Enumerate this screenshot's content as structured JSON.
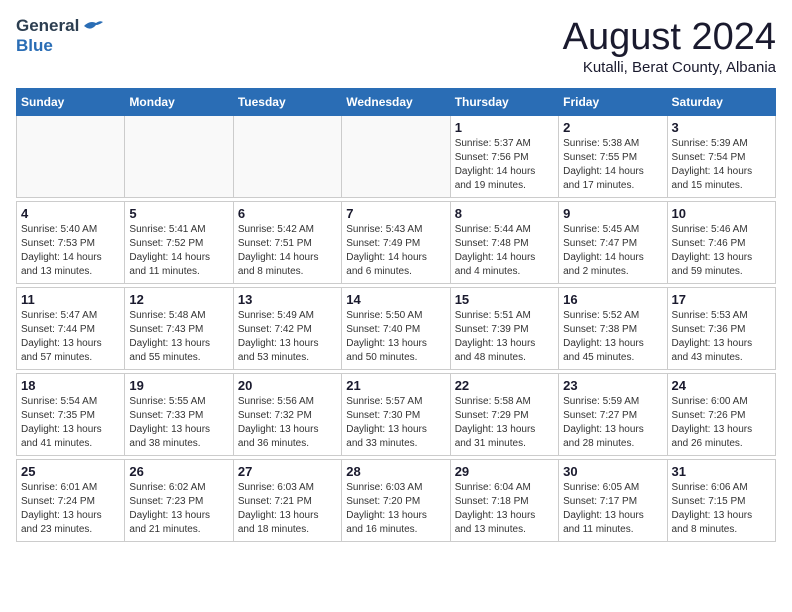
{
  "header": {
    "logo_general": "General",
    "logo_blue": "Blue",
    "month_year": "August 2024",
    "location": "Kutalli, Berat County, Albania"
  },
  "days_of_week": [
    "Sunday",
    "Monday",
    "Tuesday",
    "Wednesday",
    "Thursday",
    "Friday",
    "Saturday"
  ],
  "weeks": [
    [
      {
        "day": "",
        "info": ""
      },
      {
        "day": "",
        "info": ""
      },
      {
        "day": "",
        "info": ""
      },
      {
        "day": "",
        "info": ""
      },
      {
        "day": "1",
        "info": "Sunrise: 5:37 AM\nSunset: 7:56 PM\nDaylight: 14 hours\nand 19 minutes."
      },
      {
        "day": "2",
        "info": "Sunrise: 5:38 AM\nSunset: 7:55 PM\nDaylight: 14 hours\nand 17 minutes."
      },
      {
        "day": "3",
        "info": "Sunrise: 5:39 AM\nSunset: 7:54 PM\nDaylight: 14 hours\nand 15 minutes."
      }
    ],
    [
      {
        "day": "4",
        "info": "Sunrise: 5:40 AM\nSunset: 7:53 PM\nDaylight: 14 hours\nand 13 minutes."
      },
      {
        "day": "5",
        "info": "Sunrise: 5:41 AM\nSunset: 7:52 PM\nDaylight: 14 hours\nand 11 minutes."
      },
      {
        "day": "6",
        "info": "Sunrise: 5:42 AM\nSunset: 7:51 PM\nDaylight: 14 hours\nand 8 minutes."
      },
      {
        "day": "7",
        "info": "Sunrise: 5:43 AM\nSunset: 7:49 PM\nDaylight: 14 hours\nand 6 minutes."
      },
      {
        "day": "8",
        "info": "Sunrise: 5:44 AM\nSunset: 7:48 PM\nDaylight: 14 hours\nand 4 minutes."
      },
      {
        "day": "9",
        "info": "Sunrise: 5:45 AM\nSunset: 7:47 PM\nDaylight: 14 hours\nand 2 minutes."
      },
      {
        "day": "10",
        "info": "Sunrise: 5:46 AM\nSunset: 7:46 PM\nDaylight: 13 hours\nand 59 minutes."
      }
    ],
    [
      {
        "day": "11",
        "info": "Sunrise: 5:47 AM\nSunset: 7:44 PM\nDaylight: 13 hours\nand 57 minutes."
      },
      {
        "day": "12",
        "info": "Sunrise: 5:48 AM\nSunset: 7:43 PM\nDaylight: 13 hours\nand 55 minutes."
      },
      {
        "day": "13",
        "info": "Sunrise: 5:49 AM\nSunset: 7:42 PM\nDaylight: 13 hours\nand 53 minutes."
      },
      {
        "day": "14",
        "info": "Sunrise: 5:50 AM\nSunset: 7:40 PM\nDaylight: 13 hours\nand 50 minutes."
      },
      {
        "day": "15",
        "info": "Sunrise: 5:51 AM\nSunset: 7:39 PM\nDaylight: 13 hours\nand 48 minutes."
      },
      {
        "day": "16",
        "info": "Sunrise: 5:52 AM\nSunset: 7:38 PM\nDaylight: 13 hours\nand 45 minutes."
      },
      {
        "day": "17",
        "info": "Sunrise: 5:53 AM\nSunset: 7:36 PM\nDaylight: 13 hours\nand 43 minutes."
      }
    ],
    [
      {
        "day": "18",
        "info": "Sunrise: 5:54 AM\nSunset: 7:35 PM\nDaylight: 13 hours\nand 41 minutes."
      },
      {
        "day": "19",
        "info": "Sunrise: 5:55 AM\nSunset: 7:33 PM\nDaylight: 13 hours\nand 38 minutes."
      },
      {
        "day": "20",
        "info": "Sunrise: 5:56 AM\nSunset: 7:32 PM\nDaylight: 13 hours\nand 36 minutes."
      },
      {
        "day": "21",
        "info": "Sunrise: 5:57 AM\nSunset: 7:30 PM\nDaylight: 13 hours\nand 33 minutes."
      },
      {
        "day": "22",
        "info": "Sunrise: 5:58 AM\nSunset: 7:29 PM\nDaylight: 13 hours\nand 31 minutes."
      },
      {
        "day": "23",
        "info": "Sunrise: 5:59 AM\nSunset: 7:27 PM\nDaylight: 13 hours\nand 28 minutes."
      },
      {
        "day": "24",
        "info": "Sunrise: 6:00 AM\nSunset: 7:26 PM\nDaylight: 13 hours\nand 26 minutes."
      }
    ],
    [
      {
        "day": "25",
        "info": "Sunrise: 6:01 AM\nSunset: 7:24 PM\nDaylight: 13 hours\nand 23 minutes."
      },
      {
        "day": "26",
        "info": "Sunrise: 6:02 AM\nSunset: 7:23 PM\nDaylight: 13 hours\nand 21 minutes."
      },
      {
        "day": "27",
        "info": "Sunrise: 6:03 AM\nSunset: 7:21 PM\nDaylight: 13 hours\nand 18 minutes."
      },
      {
        "day": "28",
        "info": "Sunrise: 6:03 AM\nSunset: 7:20 PM\nDaylight: 13 hours\nand 16 minutes."
      },
      {
        "day": "29",
        "info": "Sunrise: 6:04 AM\nSunset: 7:18 PM\nDaylight: 13 hours\nand 13 minutes."
      },
      {
        "day": "30",
        "info": "Sunrise: 6:05 AM\nSunset: 7:17 PM\nDaylight: 13 hours\nand 11 minutes."
      },
      {
        "day": "31",
        "info": "Sunrise: 6:06 AM\nSunset: 7:15 PM\nDaylight: 13 hours\nand 8 minutes."
      }
    ]
  ]
}
